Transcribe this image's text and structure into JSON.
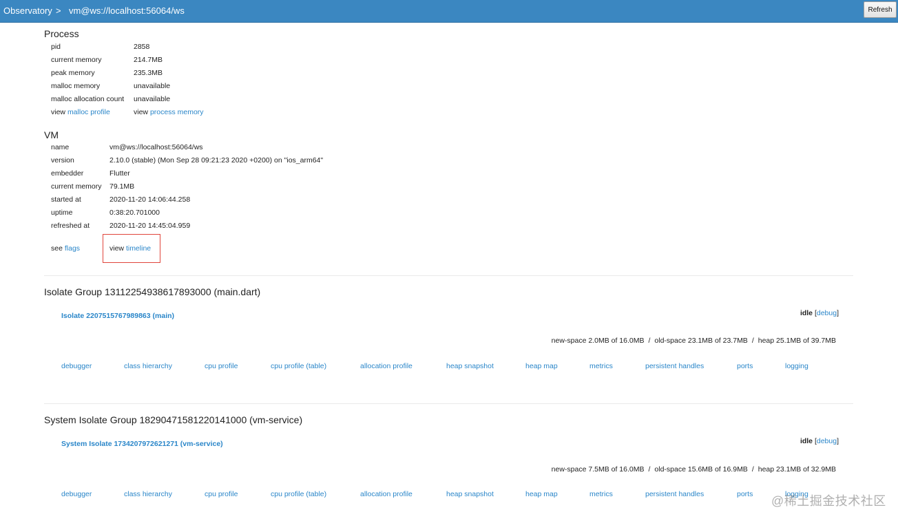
{
  "nav": {
    "crumbs": [
      "Observatory",
      "vm@ws://localhost:56064/ws"
    ],
    "separator": ">",
    "refresh_label": "Refresh"
  },
  "process": {
    "title": "Process",
    "rows": [
      {
        "label": "pid",
        "value": "2858"
      },
      {
        "label": "current memory",
        "value": "214.7MB"
      },
      {
        "label": "peak memory",
        "value": "235.3MB"
      },
      {
        "label": "malloc memory",
        "value": "unavailable"
      },
      {
        "label": "malloc allocation count",
        "value": "unavailable"
      }
    ],
    "view_prefix": "view",
    "malloc_profile_link": "malloc profile",
    "process_memory_link": "process memory"
  },
  "vm": {
    "title": "VM",
    "rows": [
      {
        "label": "name",
        "value": "vm@ws://localhost:56064/ws"
      },
      {
        "label": "version",
        "value": "2.10.0 (stable) (Mon Sep 28 09:21:23 2020 +0200) on \"ios_arm64\""
      },
      {
        "label": "embedder",
        "value": "Flutter"
      },
      {
        "label": "current memory",
        "value": "79.1MB"
      },
      {
        "label": "started at",
        "value": "2020-11-20 14:06:44.258"
      },
      {
        "label": "uptime",
        "value": "0:38:20.701000"
      },
      {
        "label": "refreshed at",
        "value": "2020-11-20 14:45:04.959"
      }
    ],
    "see_prefix": "see",
    "flags_link": "flags",
    "view_prefix": "view",
    "timeline_link": "timeline"
  },
  "groups": [
    {
      "title": "Isolate Group 13112254938617893000 (main.dart)",
      "isolate_name": "Isolate 2207515767989863 (main)",
      "status": "idle",
      "debug_link": "debug",
      "memory": {
        "new_space": "new-space 2.0MB of 16.0MB",
        "old_space": "old-space 23.1MB of 23.7MB",
        "heap": "heap 25.1MB of 39.7MB"
      },
      "links": [
        "debugger",
        "class hierarchy",
        "cpu profile",
        "cpu profile (table)",
        "allocation profile",
        "heap snapshot",
        "heap map",
        "metrics",
        "persistent handles",
        "ports",
        "logging"
      ]
    },
    {
      "title": "System Isolate Group 18290471581220141000 (vm-service)",
      "isolate_name": "System Isolate 1734207972621271 (vm-service)",
      "status": "idle",
      "debug_link": "debug",
      "memory": {
        "new_space": "new-space 7.5MB of 16.0MB",
        "old_space": "old-space 15.6MB of 16.9MB",
        "heap": "heap 23.1MB of 32.9MB"
      },
      "links": [
        "debugger",
        "class hierarchy",
        "cpu profile",
        "cpu profile (table)",
        "allocation profile",
        "heap snapshot",
        "heap map",
        "metrics",
        "persistent handles",
        "ports",
        "logging"
      ]
    }
  ],
  "memory_separator": "/",
  "watermark": "@稀土掘金技术社区"
}
